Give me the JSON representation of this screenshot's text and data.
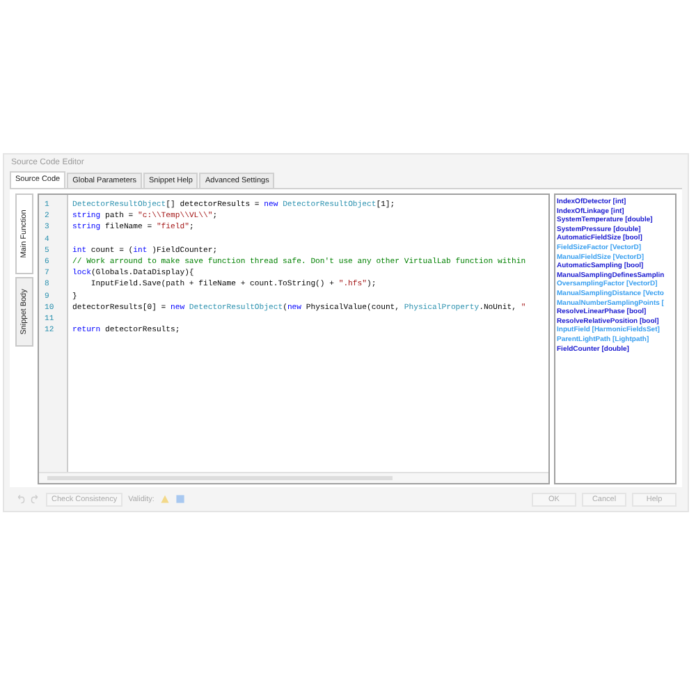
{
  "window": {
    "title": "Source Code Editor"
  },
  "tabs": [
    {
      "label": "Source Code",
      "selected": true
    },
    {
      "label": "Global Parameters",
      "selected": false
    },
    {
      "label": "Snippet Help",
      "selected": false
    },
    {
      "label": "Advanced Settings",
      "selected": false
    }
  ],
  "side_tabs": [
    {
      "label": "Main Function",
      "selected": true
    },
    {
      "label": "Snippet Body",
      "selected": false
    }
  ],
  "code": {
    "lines": [
      {
        "number": "1",
        "tokens": [
          {
            "kind": "type",
            "text": "DetectorResultObject"
          },
          {
            "kind": "plain",
            "text": "[] detectorResults = "
          },
          {
            "kind": "keyword",
            "text": "new"
          },
          {
            "kind": "type",
            "text": " DetectorResultObject"
          },
          {
            "kind": "plain",
            "text": "[1];"
          }
        ]
      },
      {
        "number": "2",
        "tokens": [
          {
            "kind": "keyword",
            "text": "string"
          },
          {
            "kind": "plain",
            "text": " path = "
          },
          {
            "kind": "string",
            "text": "\"c:\\\\Temp\\\\VL\\\\\""
          },
          {
            "kind": "plain",
            "text": ";"
          }
        ]
      },
      {
        "number": "3",
        "tokens": [
          {
            "kind": "keyword",
            "text": "string"
          },
          {
            "kind": "plain",
            "text": " fileName = "
          },
          {
            "kind": "string",
            "text": "\"field\""
          },
          {
            "kind": "plain",
            "text": ";"
          }
        ]
      },
      {
        "number": "4"
      },
      {
        "number": "5",
        "tokens": [
          {
            "kind": "keyword",
            "text": "int"
          },
          {
            "kind": "plain",
            "text": " count = ("
          },
          {
            "kind": "keyword",
            "text": "int"
          },
          {
            "kind": "plain",
            "text": " )FieldCounter;"
          }
        ]
      },
      {
        "number": "6",
        "tokens": [
          {
            "kind": "comment",
            "text": "// Work arround to make save function thread safe. Don't use any other VirtualLab function within"
          }
        ]
      },
      {
        "number": "7",
        "tokens": [
          {
            "kind": "keyword",
            "text": "lock"
          },
          {
            "kind": "plain",
            "text": "(Globals.DataDisplay){"
          }
        ]
      },
      {
        "number": "8",
        "tokens": [
          {
            "kind": "plain",
            "text": "    InputField.Save(path + fileName + count.ToString() + "
          },
          {
            "kind": "string",
            "text": "\".hfs\""
          },
          {
            "kind": "plain",
            "text": ");"
          }
        ]
      },
      {
        "number": "9",
        "tokens": [
          {
            "kind": "plain",
            "text": "}"
          }
        ]
      },
      {
        "number": "10",
        "tokens": [
          {
            "kind": "plain",
            "text": "detectorResults[0] = "
          },
          {
            "kind": "keyword",
            "text": "new"
          },
          {
            "kind": "type",
            "text": " DetectorResultObject"
          },
          {
            "kind": "plain",
            "text": "("
          },
          {
            "kind": "keyword",
            "text": "new"
          },
          {
            "kind": "plain",
            "text": " PhysicalValue(count, "
          },
          {
            "kind": "type",
            "text": "PhysicalProperty"
          },
          {
            "kind": "plain",
            "text": ".NoUnit, "
          },
          {
            "kind": "string",
            "text": "\""
          }
        ]
      },
      {
        "number": "11"
      },
      {
        "number": "12",
        "tokens": [
          {
            "kind": "keyword",
            "text": "return"
          },
          {
            "kind": "plain",
            "text": " detectorResults;"
          }
        ]
      }
    ]
  },
  "variables": [
    {
      "label": "IndexOfDetector [int]",
      "color": "#1a1ad0"
    },
    {
      "label": "IndexOfLinkage [int]",
      "color": "#1a1ad0"
    },
    {
      "label": "SystemTemperature [double]",
      "color": "#1a1ad0"
    },
    {
      "label": "SystemPressure [double]",
      "color": "#1a1ad0"
    },
    {
      "label": "AutomaticFieldSize [bool]",
      "color": "#1a1ad0"
    },
    {
      "label": "FieldSizeFactor [VectorD]",
      "color": "#3aa0f0"
    },
    {
      "label": "ManualFieldSize [VectorD]",
      "color": "#3aa0f0"
    },
    {
      "label": "AutomaticSampling [bool]",
      "color": "#1a1ad0"
    },
    {
      "label": "ManualSamplingDefinesSamplin",
      "color": "#1a1ad0"
    },
    {
      "label": "OversamplingFactor [VectorD]",
      "color": "#3aa0f0"
    },
    {
      "label": "ManualSamplingDistance [Vecto",
      "color": "#3aa0f0"
    },
    {
      "label": "ManualNumberSamplingPoints [",
      "color": "#3aa0f0"
    },
    {
      "label": "ResolveLinearPhase [bool]",
      "color": "#1a1ad0"
    },
    {
      "label": "ResolveRelativePosition [bool]",
      "color": "#1a1ad0"
    },
    {
      "label": "InputField [HarmonicFieldsSet]",
      "color": "#3aa0f0"
    },
    {
      "label": "ParentLightPath [Lightpath]",
      "color": "#3aa0f0"
    },
    {
      "label": "FieldCounter [double]",
      "color": "#1a1ad0"
    }
  ],
  "footer": {
    "check_button": "Check Consistency",
    "validity_label": "Validity:",
    "buttons": [
      "OK",
      "Cancel",
      "Help"
    ]
  }
}
